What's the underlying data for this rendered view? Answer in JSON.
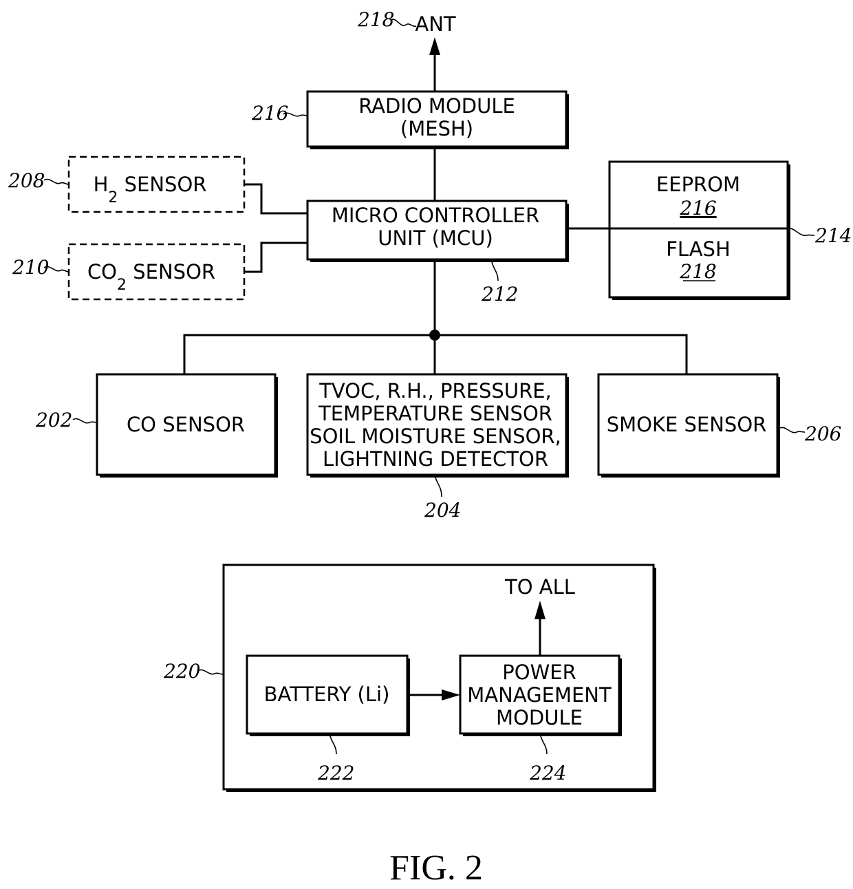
{
  "figure": {
    "caption": "FIG. 2",
    "blocks": {
      "antenna": {
        "label": "ANT",
        "ref": "218"
      },
      "radio": {
        "line1": "RADIO MODULE",
        "line2": "(MESH)",
        "ref": "216"
      },
      "mcu": {
        "line1": "MICRO CONTROLLER",
        "line2": "UNIT (MCU)",
        "ref": "212"
      },
      "h2_sensor": {
        "prefix": "H",
        "subscript": "2",
        "suffix": " SENSOR",
        "ref": "208",
        "style": "dashed"
      },
      "co2_sensor": {
        "prefix": "CO",
        "subscript": "2",
        "suffix": " SENSOR",
        "ref": "210",
        "style": "dashed"
      },
      "memory": {
        "ref": "214",
        "eeprom": {
          "label": "EEPROM",
          "ref": "216"
        },
        "flash": {
          "label": "FLASH",
          "ref": "218"
        }
      },
      "co_sensor": {
        "label": "CO SENSOR",
        "ref": "202"
      },
      "multi_sensor": {
        "lines": [
          "TVOC, R.H., PRESSURE,",
          "TEMPERATURE SENSOR",
          "SOIL MOISTURE SENSOR,",
          "LIGHTNING DETECTOR"
        ],
        "ref": "204"
      },
      "smoke_sensor": {
        "label": "SMOKE SENSOR",
        "ref": "206"
      },
      "power_section": {
        "ref": "220",
        "output_label": "TO ALL",
        "battery": {
          "label": "BATTERY (Li)",
          "ref": "222"
        },
        "power_mgmt": {
          "lines": [
            "POWER",
            "MANAGEMENT",
            "MODULE"
          ],
          "ref": "224"
        }
      }
    }
  }
}
